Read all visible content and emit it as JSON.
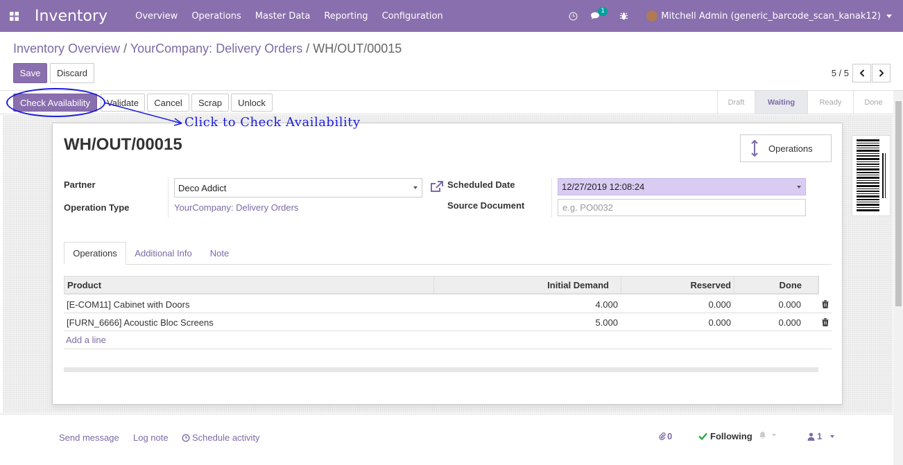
{
  "navbar": {
    "app_title": "Inventory",
    "menu": [
      "Overview",
      "Operations",
      "Master Data",
      "Reporting",
      "Configuration"
    ],
    "messages_badge": "1",
    "user_label": "Mitchell Admin (generic_barcode_scan_kanak12)",
    "icons": [
      "apps-icon",
      "clock-icon",
      "chat-icon",
      "bug-icon",
      "avatar"
    ]
  },
  "breadcrumb": {
    "item1": "Inventory Overview",
    "sep": "/",
    "item2": "YourCompany: Delivery Orders",
    "current": "WH/OUT/00015"
  },
  "actions": {
    "save": "Save",
    "discard": "Discard"
  },
  "pager": {
    "value": "5 / 5"
  },
  "statusbar": {
    "buttons": [
      "Check Availability",
      "Validate",
      "Cancel",
      "Scrap",
      "Unlock"
    ],
    "stages": [
      "Draft",
      "Waiting",
      "Ready",
      "Done"
    ],
    "active_stage": "Waiting"
  },
  "annotation": {
    "text": "Click to Check Availability",
    "color": "#1a1ae0"
  },
  "record": {
    "title": "WH/OUT/00015",
    "smart_button": "Operations",
    "partner_label": "Partner",
    "partner_value": "Deco Addict",
    "operation_type_label": "Operation Type",
    "operation_type_value": "YourCompany: Delivery Orders",
    "scheduled_date_label": "Scheduled Date",
    "scheduled_date_value": "12/27/2019 12:08:24",
    "source_document_label": "Source Document",
    "source_document_placeholder": "e.g. PO0032"
  },
  "tabs": [
    "Operations",
    "Additional Info",
    "Note"
  ],
  "table": {
    "headers": [
      "Product",
      "Initial Demand",
      "Reserved",
      "Done"
    ],
    "rows": [
      [
        "[E-COM11] Cabinet with Doors",
        "4.000",
        "0.000",
        "0.000"
      ],
      [
        "[FURN_6666] Acoustic Bloc Screens",
        "5.000",
        "0.000",
        "0.000"
      ]
    ],
    "add_line": "Add a line"
  },
  "chatter": {
    "send_message": "Send message",
    "log_note": "Log note",
    "schedule_activity": "Schedule activity",
    "attachments": "0",
    "following": "Following",
    "followers": "1"
  },
  "colors": {
    "brand": "#8a6fae",
    "link": "#7c6aa6",
    "date_field": "#d9ccf3"
  }
}
